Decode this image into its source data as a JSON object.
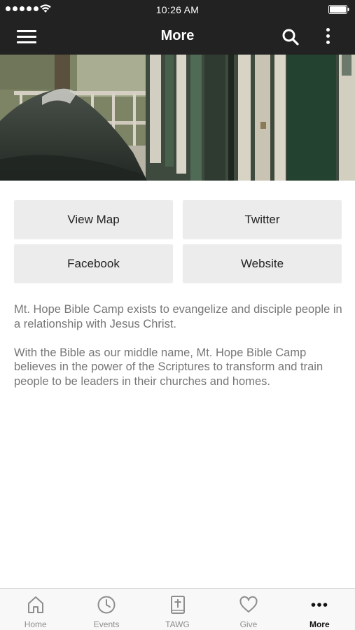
{
  "status_bar": {
    "time": "10:26 AM",
    "signal_icon": "signal-dots-icon",
    "wifi_icon": "wifi-icon",
    "battery_icon": "battery-icon"
  },
  "nav": {
    "title": "More",
    "menu_icon": "hamburger-menu-icon",
    "search_icon": "search-icon",
    "more_icon": "vertical-ellipsis-icon",
    "background": "#222222"
  },
  "buttons": {
    "view_map": "View Map",
    "twitter": "Twitter",
    "facebook": "Facebook",
    "website": "Website"
  },
  "description": {
    "p1": "Mt. Hope Bible Camp exists to evangelize and disciple people in a relationship with Jesus Christ.",
    "p2": "With the Bible as our middle name, Mt. Hope Bible Camp believes in the power of the Scriptures to transform and train people to be leaders in their churches and homes."
  },
  "tab_bar": {
    "active": "More",
    "tabs": [
      {
        "label": "Home",
        "icon": "home-icon"
      },
      {
        "label": "Events",
        "icon": "clock-icon"
      },
      {
        "label": "TAWG",
        "icon": "bible-icon"
      },
      {
        "label": "Give",
        "icon": "heart-icon"
      },
      {
        "label": "More",
        "icon": "more-dots-icon"
      }
    ]
  },
  "colors": {
    "bar_dark": "#222222",
    "button_bg": "#ececec",
    "body_text": "#777777",
    "tab_inactive": "#8e8e8e"
  }
}
